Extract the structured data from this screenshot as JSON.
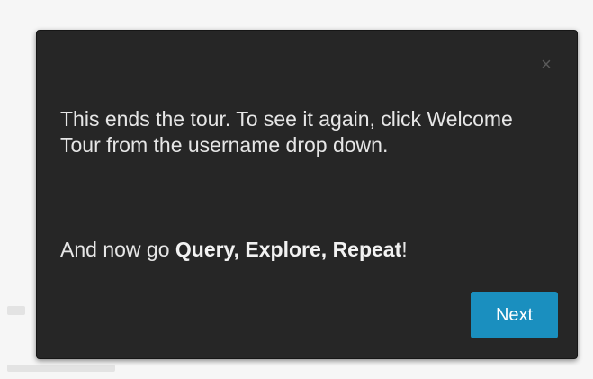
{
  "tour": {
    "message": "This ends the tour. To see it again, click Welcome Tour from the username drop down.",
    "outro_prefix": "And now go ",
    "outro_emphasis": "Query, Explore, Repeat",
    "outro_suffix": "!",
    "close_glyph": "×",
    "next_label": "Next"
  },
  "colors": {
    "popover_background": "#262626",
    "accent": "#1a8fbf",
    "text": "#e6e6e6"
  },
  "icons": {
    "close": "close-icon"
  }
}
